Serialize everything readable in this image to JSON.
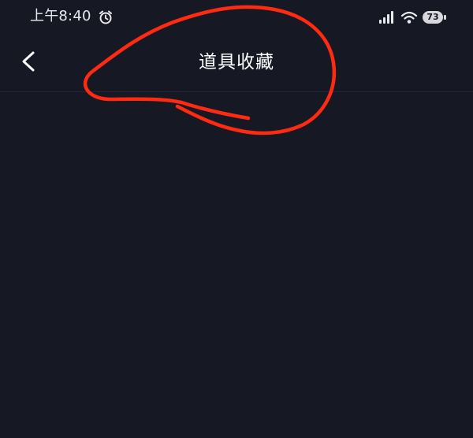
{
  "status_bar": {
    "time": "上午8:40",
    "battery_level": "73",
    "icons": [
      "alarm-icon",
      "signal-icon",
      "wifi-icon",
      "battery-icon"
    ]
  },
  "nav": {
    "back_icon": "chevron-left-icon",
    "title": "道具收藏"
  },
  "annotation": {
    "color": "#ff2a12"
  },
  "colors": {
    "background": "#161824",
    "divider": "#22263a",
    "text": "#ffffff"
  }
}
